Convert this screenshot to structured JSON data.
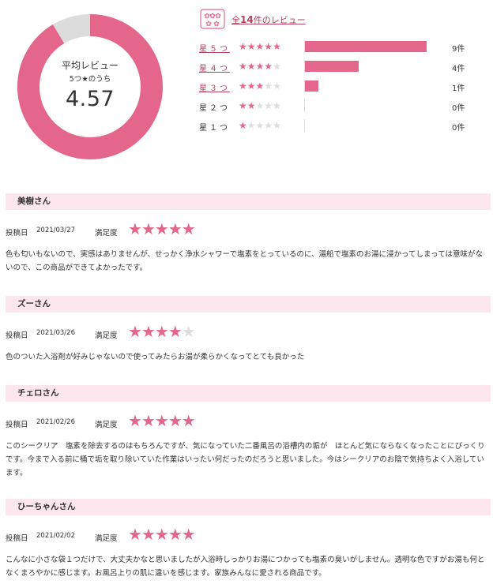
{
  "summary": {
    "title": "平均レビュー",
    "subtitle": "5つ★のうち",
    "average": "4.57",
    "average_fraction": 0.914,
    "total_prefix": "全",
    "total_count": "14",
    "total_suffix": "件のレビュー",
    "colors": {
      "accent": "#e4668a",
      "track": "#dcdcdc",
      "link": "#b3405e",
      "band": "#fde6ee"
    }
  },
  "breakdown": [
    {
      "label": "星５つ",
      "stars": 5,
      "count_text": "9件",
      "count": 9,
      "linked": true
    },
    {
      "label": "星４つ",
      "stars": 4,
      "count_text": "4件",
      "count": 4,
      "linked": true
    },
    {
      "label": "星３つ",
      "stars": 3,
      "count_text": "1件",
      "count": 1,
      "linked": true
    },
    {
      "label": "星２つ",
      "stars": 2,
      "count_text": "0件",
      "count": 0,
      "linked": false
    },
    {
      "label": "星１つ",
      "stars": 1,
      "count_text": "0件",
      "count": 0,
      "linked": false
    }
  ],
  "labels": {
    "posted": "投稿日",
    "satisfaction": "満足度"
  },
  "reviews": [
    {
      "name": "美樹さん",
      "date": "2021/03/27",
      "rating": 5,
      "text": "色も匂いもないので、実感はありませんが、せっかく浄水シャワーで塩素をとっているのに、湯船で塩素のお湯に浸かってしまっては意味がないので、この商品ができてよかったです。"
    },
    {
      "name": "ズーさん",
      "date": "2021/03/26",
      "rating": 4,
      "text": "色のついた入浴剤が好みじゃないので使ってみたらお湯が柔らかくなってとても良かった"
    },
    {
      "name": "チェロさん",
      "date": "2021/02/26",
      "rating": 5,
      "text": "このシークリア　塩素を除去するのはもちろんですが、気になっていた二番風呂の浴槽内の垢が　ほとんど気にならなくなったことにびっくりです。今まで入る前に桶で垢を取り除いていた作業はいったい何だったのだろうと思いました。今はシークリアのお陰で気持ちよく入浴しています。"
    },
    {
      "name": "ひーちゃんさん",
      "date": "2021/02/02",
      "rating": 5,
      "text": "こんなに小さな袋１つだけで、大丈夫かなと思いましたが入浴時しっかりお湯につかっても塩素の臭いがしません。透明な色ですがお湯も何となくまろやかに感じます。お風呂上りの肌に違いを感じます。家族みんなに愛される商品です。"
    }
  ]
}
